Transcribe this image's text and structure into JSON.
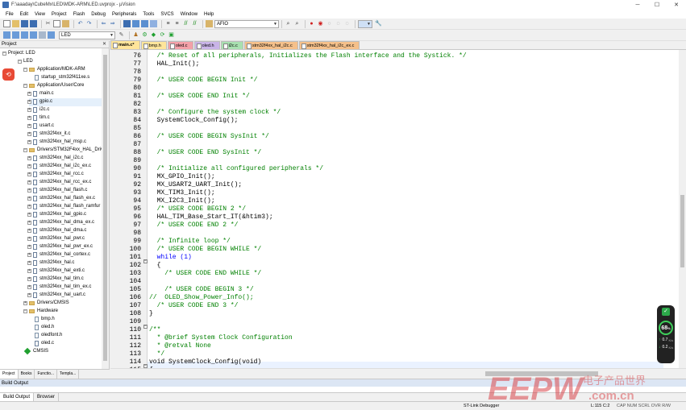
{
  "window": {
    "title": "F:\\aaaday\\CubeMx\\LED\\MDK-ARM\\LED.uvprojx - µVision",
    "controls": [
      "─",
      "☐",
      "✕"
    ]
  },
  "menu": [
    "File",
    "Edit",
    "View",
    "Project",
    "Flash",
    "Debug",
    "Peripherals",
    "Tools",
    "SVCS",
    "Window",
    "Help"
  ],
  "toolbar": {
    "find_combo": "AFIO",
    "target_combo": "LED"
  },
  "project_panel": {
    "header": "Project",
    "close": "✕",
    "tree": [
      {
        "label": "Project: LED",
        "type": "root"
      },
      {
        "label": "LED",
        "type": "target"
      },
      {
        "label": "Application/MDK-ARM",
        "type": "folder"
      },
      {
        "label": "startup_stm32f411xe.s",
        "type": "file"
      },
      {
        "label": "Application/User/Core",
        "type": "folder"
      },
      {
        "label": "main.c",
        "type": "file"
      },
      {
        "label": "gpio.c",
        "type": "file"
      },
      {
        "label": "i2c.c",
        "type": "file"
      },
      {
        "label": "tim.c",
        "type": "file"
      },
      {
        "label": "usart.c",
        "type": "file"
      },
      {
        "label": "stm32f4xx_it.c",
        "type": "file"
      },
      {
        "label": "stm32f4xx_hal_msp.c",
        "type": "file"
      },
      {
        "label": "Drivers/STM32F4xx_HAL_Driver",
        "type": "folder"
      },
      {
        "label": "stm32f4xx_hal_i2c.c",
        "type": "file"
      },
      {
        "label": "stm32f4xx_hal_i2c_ex.c",
        "type": "file"
      },
      {
        "label": "stm32f4xx_hal_rcc.c",
        "type": "file"
      },
      {
        "label": "stm32f4xx_hal_rcc_ex.c",
        "type": "file"
      },
      {
        "label": "stm32f4xx_hal_flash.c",
        "type": "file"
      },
      {
        "label": "stm32f4xx_hal_flash_ex.c",
        "type": "file"
      },
      {
        "label": "stm32f4xx_hal_flash_ramfur",
        "type": "file"
      },
      {
        "label": "stm32f4xx_hal_gpio.c",
        "type": "file"
      },
      {
        "label": "stm32f4xx_hal_dma_ex.c",
        "type": "file"
      },
      {
        "label": "stm32f4xx_hal_dma.c",
        "type": "file"
      },
      {
        "label": "stm32f4xx_hal_pwr.c",
        "type": "file"
      },
      {
        "label": "stm32f4xx_hal_pwr_ex.c",
        "type": "file"
      },
      {
        "label": "stm32f4xx_hal_cortex.c",
        "type": "file"
      },
      {
        "label": "stm32f4xx_hal.c",
        "type": "file"
      },
      {
        "label": "stm32f4xx_hal_exti.c",
        "type": "file"
      },
      {
        "label": "stm32f4xx_hal_tim.c",
        "type": "file"
      },
      {
        "label": "stm32f4xx_hal_tim_ex.c",
        "type": "file"
      },
      {
        "label": "stm32f4xx_hal_uart.c",
        "type": "file"
      },
      {
        "label": "Drivers/CMSIS",
        "type": "folder"
      },
      {
        "label": "Hardware",
        "type": "folder"
      },
      {
        "label": "bmp.h",
        "type": "file"
      },
      {
        "label": "oled.h",
        "type": "file"
      },
      {
        "label": "oledfont.h",
        "type": "file"
      },
      {
        "label": "oled.c",
        "type": "file"
      },
      {
        "label": "CMSIS",
        "type": "gem"
      }
    ],
    "bottom_tabs": [
      "Project",
      "Books",
      "Functio...",
      "Templa..."
    ]
  },
  "editor_tabs": [
    {
      "label": "main.c*",
      "color": "#ffe59a",
      "active": true
    },
    {
      "label": "bmp.h",
      "color": "#ffe59a"
    },
    {
      "label": "oled.c",
      "color": "#f3a0a8"
    },
    {
      "label": "oled.h",
      "color": "#c9b4e8"
    },
    {
      "label": "i2c.c",
      "color": "#a8e0b0"
    },
    {
      "label": "stm32f4xx_hal_i2c.c",
      "color": "#f5c08a"
    },
    {
      "label": "stm32f4xx_hal_i2c_ex.c",
      "color": "#f5c08a"
    }
  ],
  "code_lines": [
    {
      "n": "76",
      "t": "  /* Reset of all peripherals, Initializes the Flash interface and the Systick. */",
      "c": "cm"
    },
    {
      "n": "77",
      "t": "  HAL_Init();",
      "c": ""
    },
    {
      "n": "78",
      "t": "",
      "c": ""
    },
    {
      "n": "79",
      "t": "  /* USER CODE BEGIN Init */",
      "c": "cm"
    },
    {
      "n": "80",
      "t": "",
      "c": ""
    },
    {
      "n": "81",
      "t": "  /* USER CODE END Init */",
      "c": "cm"
    },
    {
      "n": "82",
      "t": "",
      "c": ""
    },
    {
      "n": "83",
      "t": "  /* Configure the system clock */",
      "c": "cm"
    },
    {
      "n": "84",
      "t": "  SystemClock_Config();",
      "c": ""
    },
    {
      "n": "85",
      "t": "",
      "c": ""
    },
    {
      "n": "86",
      "t": "  /* USER CODE BEGIN SysInit */",
      "c": "cm"
    },
    {
      "n": "87",
      "t": "",
      "c": ""
    },
    {
      "n": "88",
      "t": "  /* USER CODE END SysInit */",
      "c": "cm"
    },
    {
      "n": "89",
      "t": "",
      "c": ""
    },
    {
      "n": "90",
      "t": "  /* Initialize all configured peripherals */",
      "c": "cm"
    },
    {
      "n": "91",
      "t": "  MX_GPIO_Init();",
      "c": ""
    },
    {
      "n": "92",
      "t": "  MX_USART2_UART_Init();",
      "c": ""
    },
    {
      "n": "93",
      "t": "  MX_TIM3_Init();",
      "c": ""
    },
    {
      "n": "94",
      "t": "  MX_I2C3_Init();",
      "c": ""
    },
    {
      "n": "95",
      "t": "  /* USER CODE BEGIN 2 */",
      "c": "cm"
    },
    {
      "n": "96",
      "t": "  HAL_TIM_Base_Start_IT(&htim3);",
      "c": ""
    },
    {
      "n": "97",
      "t": "  /* USER CODE END 2 */",
      "c": "cm"
    },
    {
      "n": "98",
      "t": "",
      "c": ""
    },
    {
      "n": "99",
      "t": "  /* Infinite loop */",
      "c": "cm"
    },
    {
      "n": "100",
      "t": "  /* USER CODE BEGIN WHILE */",
      "c": "cm"
    },
    {
      "n": "101",
      "t": "  while (1)",
      "c": "kw"
    },
    {
      "n": "102",
      "t": "  {",
      "c": ""
    },
    {
      "n": "103",
      "t": "    /* USER CODE END WHILE */",
      "c": "cm"
    },
    {
      "n": "104",
      "t": "",
      "c": ""
    },
    {
      "n": "105",
      "t": "    /* USER CODE BEGIN 3 */",
      "c": "cm"
    },
    {
      "n": "106",
      "t": "//  OLED_Show_Power_Info();",
      "c": "cm"
    },
    {
      "n": "107",
      "t": "  /* USER CODE END 3 */",
      "c": "cm"
    },
    {
      "n": "108",
      "t": "}",
      "c": ""
    },
    {
      "n": "109",
      "t": "",
      "c": ""
    },
    {
      "n": "110",
      "t": "/**",
      "c": "cm"
    },
    {
      "n": "111",
      "t": "  * @brief System Clock Configuration",
      "c": "cm"
    },
    {
      "n": "112",
      "t": "  * @retval None",
      "c": "cm"
    },
    {
      "n": "113",
      "t": "  */",
      "c": "cm"
    },
    {
      "n": "114",
      "t": "void SystemClock_Config(void)",
      "c": ""
    },
    {
      "n": "115",
      "t": "{",
      "c": ""
    }
  ],
  "build_output": {
    "header": "Build Output",
    "tabs": [
      "Build Output",
      "Browser"
    ]
  },
  "status": {
    "debugger": "ST-Link Debugger",
    "position": "L:115 C:2",
    "flags": "CAP  NUM  SCRL  OVR  R/W"
  },
  "perf_widget": {
    "value": "68",
    "unit": "%",
    "up_rate": "0.7",
    "up_unit": "K/s",
    "down_rate": "0.2",
    "down_unit": "K/s"
  },
  "watermark": {
    "logo": "EEPW",
    "text": "电子产品世界",
    "domain": ".com.cn"
  }
}
